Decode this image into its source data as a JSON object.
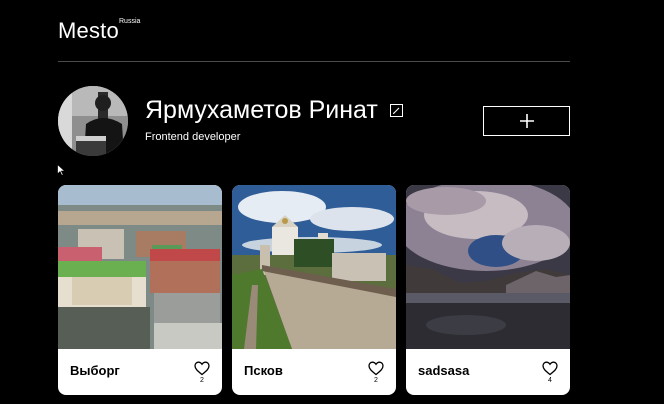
{
  "header": {
    "logo": "Mesto",
    "logo_sup": "Russia"
  },
  "profile": {
    "name": "Ярмухаметов Ринат",
    "about": "Frontend developer",
    "edit_icon": "pencil-edit-icon",
    "add_icon": "plus-icon"
  },
  "cards": [
    {
      "title": "Выборг",
      "likes": "2"
    },
    {
      "title": "Псков",
      "likes": "2"
    },
    {
      "title": "sadsasa",
      "likes": "4"
    }
  ],
  "colors": {
    "background": "#000000",
    "card": "#ffffff",
    "text": "#ffffff",
    "divider": "#4b4b4b"
  }
}
